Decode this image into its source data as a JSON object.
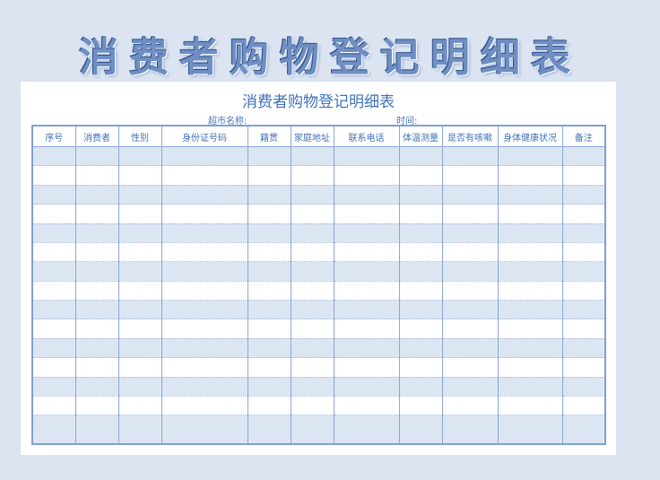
{
  "banner": {
    "title": "消费者购物登记明细表"
  },
  "sheet": {
    "title": "消费者购物登记明细表",
    "store_label": "超市名称:",
    "time_label": "时间:"
  },
  "table": {
    "headers": [
      "序号",
      "消费者",
      "性别",
      "身份证号码",
      "籍贯",
      "家庭地址",
      "联系电话",
      "体温测量",
      "是否有咳嗽",
      "身体健康状况",
      "备注"
    ],
    "row_count": 15
  }
}
